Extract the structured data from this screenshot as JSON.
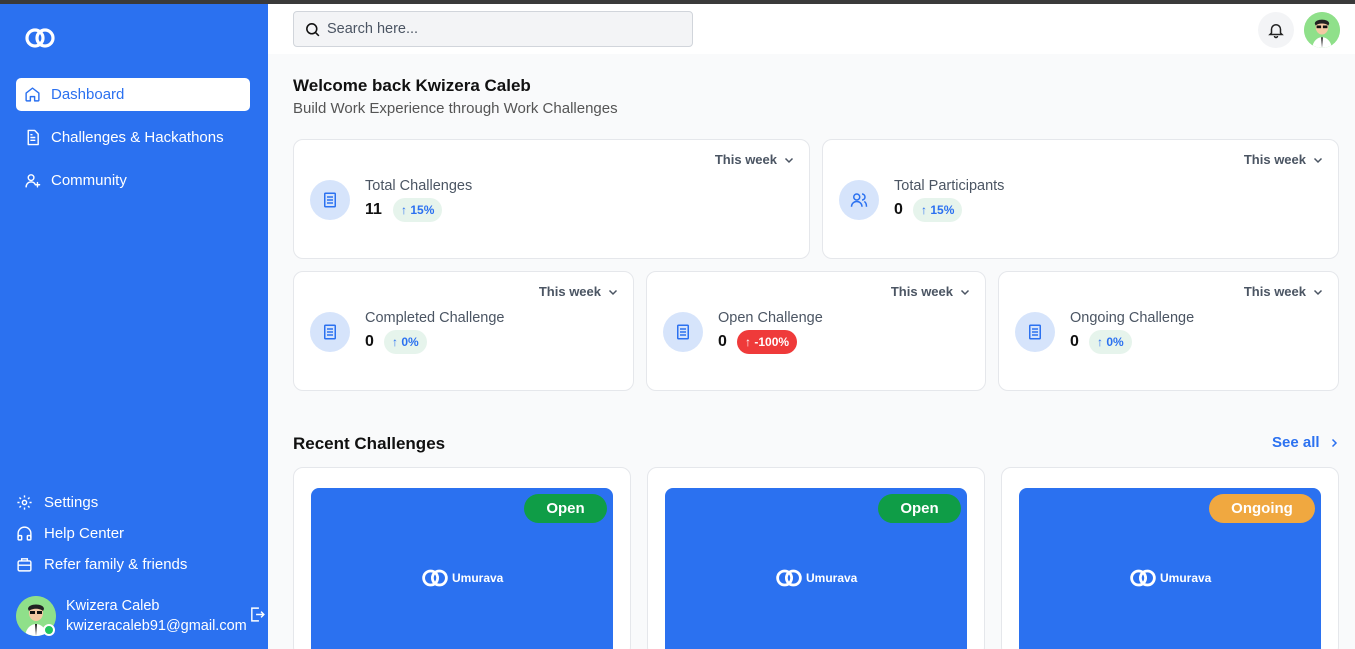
{
  "sidebar": {
    "nav": [
      {
        "label": "Dashboard",
        "icon": "home-icon",
        "active": true
      },
      {
        "label": "Challenges & Hackathons",
        "icon": "document-icon",
        "active": false
      },
      {
        "label": "Community",
        "icon": "user-plus-icon",
        "active": false
      }
    ],
    "bottom": [
      {
        "label": "Settings",
        "icon": "gear-icon"
      },
      {
        "label": "Help Center",
        "icon": "headphones-icon"
      },
      {
        "label": "Refer family & friends",
        "icon": "briefcase-icon"
      }
    ],
    "user": {
      "name": "Kwizera Caleb",
      "email": "kwizeracaleb91@gmail.com"
    }
  },
  "header": {
    "search_placeholder": "Search here..."
  },
  "main": {
    "welcome": "Welcome back Kwizera Caleb",
    "subtitle": "Build Work Experience through Work Challenges",
    "stats": [
      {
        "label": "Total Challenges",
        "value": "11",
        "change": "15%",
        "direction": "up",
        "period": "This week"
      },
      {
        "label": "Total Participants",
        "value": "0",
        "change": "15%",
        "direction": "up",
        "period": "This week"
      },
      {
        "label": "Completed Challenge",
        "value": "0",
        "change": "0%",
        "direction": "up",
        "period": "This week"
      },
      {
        "label": "Open Challenge",
        "value": "0",
        "change": "-100%",
        "direction": "down",
        "period": "This week"
      },
      {
        "label": "Ongoing Challenge",
        "value": "0",
        "change": "0%",
        "direction": "up",
        "period": "This week"
      }
    ],
    "recent": {
      "title": "Recent Challenges",
      "see_all": "See all",
      "cards": [
        {
          "status": "Open",
          "brand": "Umurava"
        },
        {
          "status": "Open",
          "brand": "Umurava"
        },
        {
          "status": "Ongoing",
          "brand": "Umurava"
        }
      ]
    }
  },
  "colors": {
    "primary": "#2b71f0",
    "open": "#0f9d47",
    "ongoing": "#f0a840",
    "negative": "#ef3a3a"
  }
}
